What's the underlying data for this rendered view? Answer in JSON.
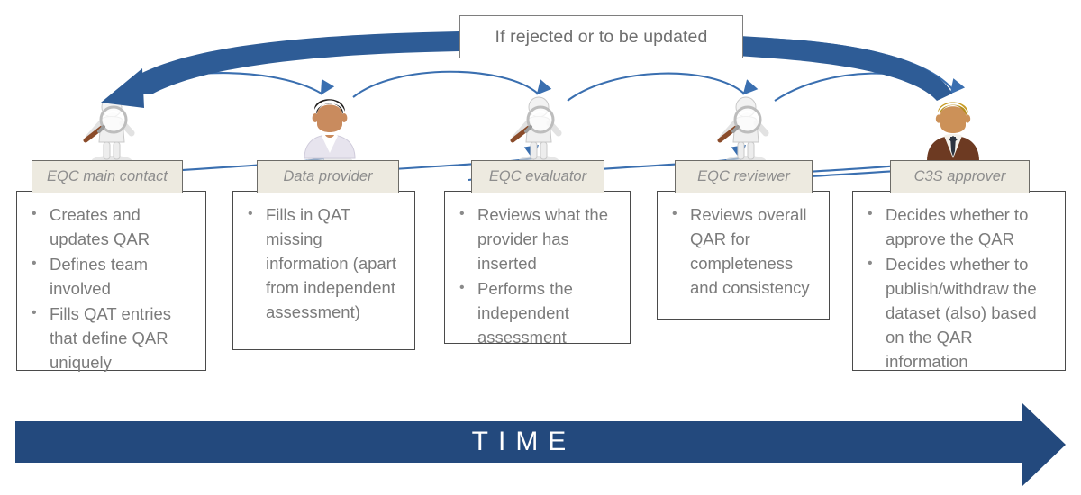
{
  "diagram": {
    "title": "QAR workflow roles over time",
    "condition_box": {
      "label": "If rejected or to be updated"
    },
    "timeline": {
      "label": "TIME",
      "color": "#23497d"
    },
    "colors": {
      "thin_arrow": "#3a6fb0",
      "thick_arrow": "#2e5c96",
      "label_fill": "#edeae0",
      "label_border": "#6d6c68",
      "label_text": "#8d8d8d",
      "box_border": "#4a4a4a",
      "bullet_text": "#7b7b7b",
      "condition_text": "#6f6f6f",
      "condition_border": "#7e7e7e"
    },
    "stages": [
      {
        "role": "EQC main contact",
        "icon": "magnifier-figure-icon",
        "tasks": [
          "Creates and updates QAR",
          "Defines team involved",
          "Fills QAT entries that define QAR uniquely"
        ]
      },
      {
        "role": "Data provider",
        "icon": "person-bust-icon",
        "tasks": [
          "Fills in QAT missing information (apart from independent assessment)"
        ]
      },
      {
        "role": "EQC evaluator",
        "icon": "magnifier-figure-icon",
        "tasks": [
          "Reviews what the provider has inserted",
          "Performs the independent assessment"
        ]
      },
      {
        "role": "EQC reviewer",
        "icon": "magnifier-figure-icon",
        "tasks": [
          "Reviews overall QAR for completeness and consistency"
        ]
      },
      {
        "role": "C3S approver",
        "icon": "businessman-icon",
        "tasks": [
          "Decides whether to approve the QAR",
          "Decides whether to publish/withdraw the dataset (also) based on the QAR information"
        ]
      }
    ]
  }
}
